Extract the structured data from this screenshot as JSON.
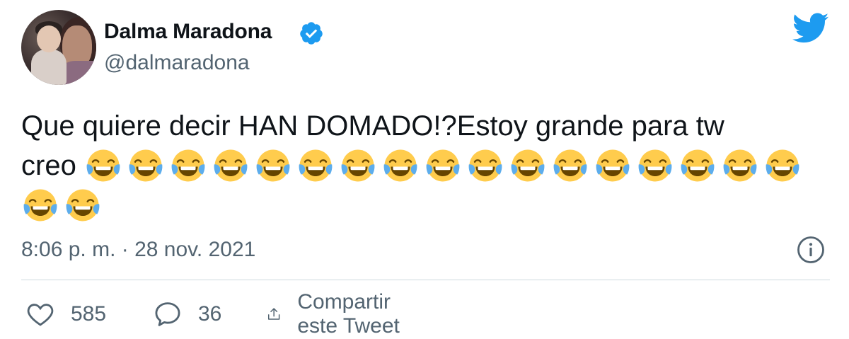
{
  "author": {
    "name": "Dalma Maradona",
    "handle": "@dalmaradona",
    "verified": true,
    "avatar_description_icon": "avatar-photo"
  },
  "tweet": {
    "line1": "Que quiere decir HAN DOMADO!?Estoy grande para tw",
    "line2_text": "creo",
    "emoji": "😂",
    "emoji_icon": "face-with-tears-of-joy-icon",
    "emoji_count": 19,
    "timestamp": "8:06 p. m. · 28 nov. 2021"
  },
  "actions": {
    "likes": "585",
    "replies": "36",
    "share_label": "Compartir este Tweet"
  },
  "colors": {
    "twitter_blue": "#1d9bf0",
    "text_primary": "#0f1419",
    "text_secondary": "#536471",
    "divider": "#cfd9de"
  }
}
